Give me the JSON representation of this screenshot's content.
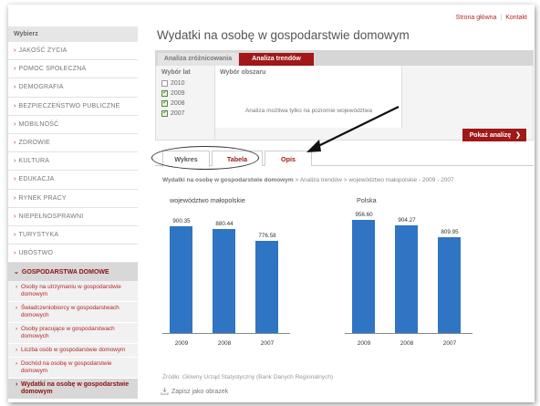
{
  "header": {
    "links": [
      "Strona główna",
      "Kontakt"
    ]
  },
  "sidebar": {
    "header": "Wybierz",
    "items": [
      "JAKOŚĆ ŻYCIA",
      "POMOC SPOŁECZNA",
      "DEMOGRAFIA",
      "BEZPIECZEŃSTWO PUBLICZNE",
      "MOBILNOŚĆ",
      "ZDROWIE",
      "KULTURA",
      "EDUKACJA",
      "RYNEK PRACY",
      "NIEPEŁNOSPRAWNI",
      "TURYSTYKA",
      "UBÓSTWO"
    ],
    "active": "GOSPODARSTWA DOMOWE",
    "subitems": [
      "Osoby na utrzymaniu w gospodarstwie domowym",
      "Świadczeniobiorcy w gospodarstwach domowych",
      "Osoby pracujące w gospodarstwach domowych",
      "Liczba osób w gospodarstwie domowym",
      "Dochód na osobę w gospodarstwie domowym",
      "Wydatki na osobę w gospodarstwie domowym"
    ]
  },
  "main": {
    "title": "Wydatki na osobę w gospodarstwie domowym",
    "tabs": [
      "Analiza zróżnicowania",
      "Analiza trendów"
    ],
    "active_tab": "Analiza trendów",
    "years_label": "Wybór lat",
    "years": [
      {
        "label": "2010",
        "checked": false
      },
      {
        "label": "2009",
        "checked": true
      },
      {
        "label": "2008",
        "checked": true
      },
      {
        "label": "2007",
        "checked": true
      }
    ],
    "area_label": "Wybór obszaru",
    "area_message": "Analiza możliwa tylko na poziomie województwa",
    "show_button": "Pokaż analizę",
    "view_tabs": [
      "Wykres",
      "Tabela",
      "Opis"
    ],
    "breadcrumb_bold": "Wydatki na osobę w gospodarstwie domowym",
    "breadcrumb_rest": " > Analiza trendów > województwo małopolskie - 2009 - 2007",
    "source": "Źródło: Główny Urząd Statystyczny (Bank Danych Regionalnych)",
    "save_label": "Zapisz jako obrazek"
  },
  "chart_data": [
    {
      "type": "bar",
      "title": "województwo małopolskie",
      "categories": [
        "2009",
        "2008",
        "2007"
      ],
      "values": [
        900.35,
        880.44,
        776.58
      ],
      "value_labels": [
        "900.35",
        "880.44",
        "776.58"
      ],
      "color": "#2f75c3"
    },
    {
      "type": "bar",
      "title": "Polska",
      "categories": [
        "2009",
        "2008",
        "2007"
      ],
      "values": [
        956.6,
        904.27,
        809.95
      ],
      "value_labels": [
        "956.60",
        "904.27",
        "809.95"
      ],
      "color": "#2f75c3"
    }
  ],
  "colors": {
    "accent": "#a01818",
    "bar": "#2f75c3"
  }
}
